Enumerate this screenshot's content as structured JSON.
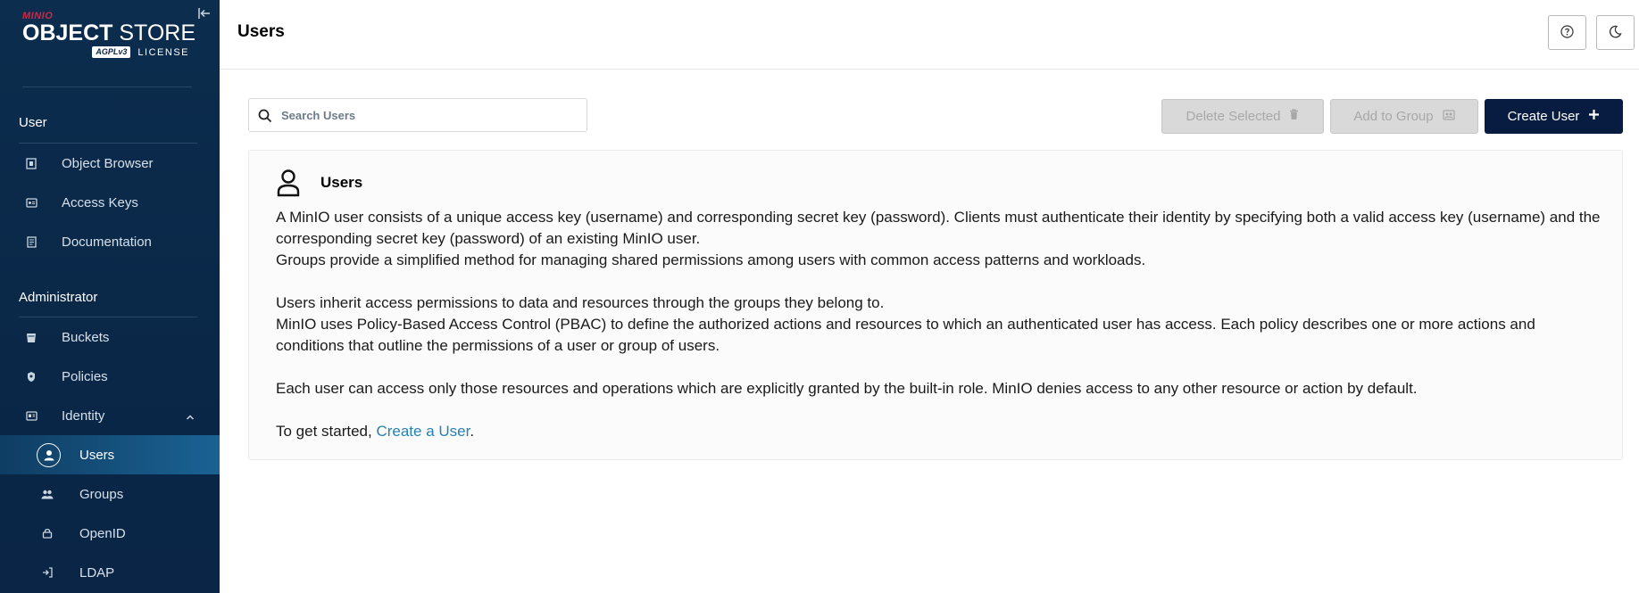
{
  "sidebar": {
    "logo": {
      "brand": "MINIO",
      "product_bold": "OBJECT",
      "product_thin": "STORE",
      "license_badge": "AGPLv3",
      "license_label": "LICENSE"
    },
    "sections": {
      "user": "User",
      "admin": "Administrator"
    },
    "user_items": [
      {
        "label": "Object Browser",
        "icon": "object-browser-icon"
      },
      {
        "label": "Access Keys",
        "icon": "access-keys-icon"
      },
      {
        "label": "Documentation",
        "icon": "documentation-icon"
      }
    ],
    "admin_items": [
      {
        "label": "Buckets",
        "icon": "buckets-icon"
      },
      {
        "label": "Policies",
        "icon": "policies-icon"
      },
      {
        "label": "Identity",
        "icon": "identity-icon"
      }
    ],
    "identity_items": [
      {
        "label": "Users",
        "icon": "user-icon",
        "active": true
      },
      {
        "label": "Groups",
        "icon": "groups-icon"
      },
      {
        "label": "OpenID",
        "icon": "openid-icon"
      },
      {
        "label": "LDAP",
        "icon": "ldap-icon"
      }
    ]
  },
  "header": {
    "title": "Users",
    "help_icon": "help-icon",
    "theme_icon": "moon-icon"
  },
  "toolbar": {
    "search_placeholder": "Search Users",
    "delete_label": "Delete Selected",
    "add_group_label": "Add to Group",
    "create_label": "Create User"
  },
  "info": {
    "title": "Users",
    "p1": "A MinIO user consists of a unique access key (username) and corresponding secret key (password). Clients must authenticate their identity by specifying both a valid access key (username) and the corresponding secret key (password) of an existing MinIO user.",
    "p2": "Groups provide a simplified method for managing shared permissions among users with common access patterns and workloads.",
    "p3": "Users inherit access permissions to data and resources through the groups they belong to.",
    "p4": "MinIO uses Policy-Based Access Control (PBAC) to define the authorized actions and resources to which an authenticated user has access. Each policy describes one or more actions and conditions that outline the permissions of a user or group of users.",
    "p5": "Each user can access only those resources and operations which are explicitly granted by the built-in role. MinIO denies access to any other resource or action by default.",
    "cta_prefix": "To get started, ",
    "cta_link": "Create a User",
    "cta_suffix": "."
  },
  "colors": {
    "sidebar_bg": "#0c2d4e",
    "active_item": "#1a6293",
    "primary_button": "#081c42",
    "link": "#2781b0",
    "brand_red": "#c72c48"
  }
}
